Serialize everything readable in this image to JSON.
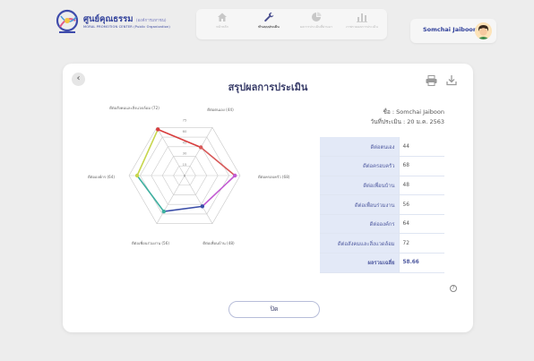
{
  "app": {
    "title": "ศูนย์คุณธรรม",
    "title_suffix": "(องค์การมหาชน)",
    "subtitle": "MORAL PROMOTION CENTER (Public Organization)"
  },
  "nav": {
    "items": [
      {
        "label": "หน้าหลัก",
        "icon": "home-icon",
        "active": false
      },
      {
        "label": "ทำแบบประเมิน",
        "icon": "wrench-icon",
        "active": true
      },
      {
        "label": "ผลการประเมินที่ผ่านมา",
        "icon": "pie-chart-icon",
        "active": false
      },
      {
        "label": "ภาพรวมผลการประเมิน",
        "icon": "bar-chart-icon",
        "active": false
      }
    ]
  },
  "user": {
    "name": "Somchai Jaiboon"
  },
  "card": {
    "title": "สรุปผลการประเมิน",
    "info_name": "ชื่อ : Somchai Jaiboon",
    "info_date": "วันที่ประเมิน : 20 ม.ค. 2563",
    "close_label": "ปิด",
    "back_icon": "chevron-left-icon",
    "print_icon": "printer-icon",
    "download_icon": "download-icon"
  },
  "table": {
    "rows": [
      {
        "label": "ดีต่อตนเอง",
        "value": "44"
      },
      {
        "label": "ดีต่อครอบครัว",
        "value": "68"
      },
      {
        "label": "ดีต่อเพื่อนบ้าน",
        "value": "48"
      },
      {
        "label": "ดีต่อเพื่อนร่วมงาน",
        "value": "56"
      },
      {
        "label": "ดีต่อองค์กร",
        "value": "64"
      },
      {
        "label": "ดีต่อสังคมและสิ่งแวดล้อม",
        "value": "72"
      }
    ],
    "total_label": "ผลรวมเฉลี่ย",
    "total_value": "58.66"
  },
  "chart_data": {
    "type": "radar",
    "axes": [
      {
        "label": "ดีต่อตนเอง (44)",
        "value": 44
      },
      {
        "label": "ดีต่อครอบครัว (68)",
        "value": 68
      },
      {
        "label": "ดีต่อเพื่อนบ้าน (48)",
        "value": 48
      },
      {
        "label": "ดีต่อเพื่อนร่วมงาน (56)",
        "value": 56
      },
      {
        "label": "ดีต่อองค์กร (64)",
        "value": 64
      },
      {
        "label": "ดีต่อสังคมและสิ่งแวดล้อม (72)",
        "value": 72
      }
    ],
    "ticks": [
      15,
      30,
      45,
      60,
      75
    ],
    "range": [
      0,
      75
    ],
    "point_colors": [
      "#d85a5a",
      "#c25bd2",
      "#3b4ea8",
      "#3fb0a0",
      "#c7d64d",
      "#d83d3d"
    ]
  }
}
